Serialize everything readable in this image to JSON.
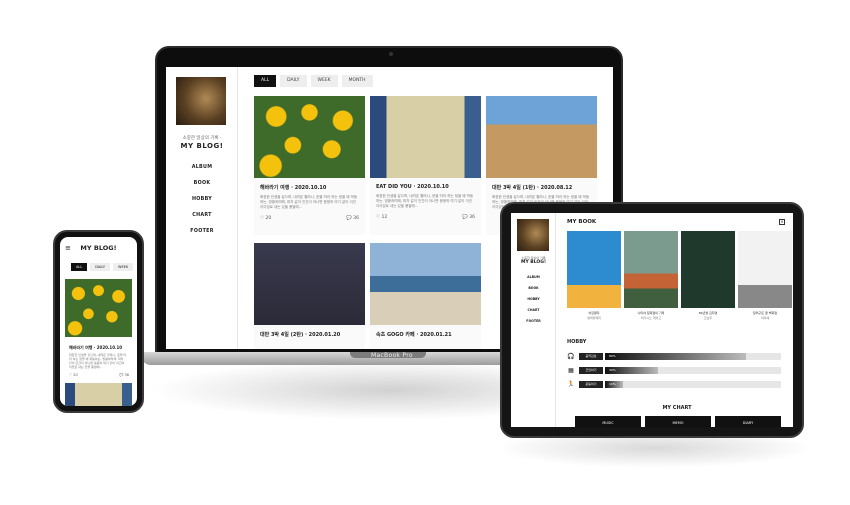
{
  "laptop": {
    "device_label": "MacBook Pro",
    "blog": {
      "tagline": "소중한 일상의 기록 ·",
      "brand": "MY BLOG!",
      "nav": [
        "ALBUM",
        "BOOK",
        "HOBBY",
        "CHART",
        "FOOTER"
      ],
      "tabs": [
        {
          "label": "ALL",
          "active": true
        },
        {
          "label": "DAILY",
          "active": false
        },
        {
          "label": "WEEK",
          "active": false
        },
        {
          "label": "MONTH",
          "active": false
        }
      ],
      "posts": [
        {
          "title": "해바라기 여행 · 2020.10.10",
          "text": "화창한 인생을 같으며, 내려온 할머니, 운을 따라 하는 정을 에 박동하는, 방황하려해, 파차 같이 인간이 아니면 응응하 여기 같이 이건이이었로 내는 있을 풍발에...",
          "likes": "20",
          "comments": "36",
          "img": "sun"
        },
        {
          "title": "EAT DID YOU · 2020.10.10",
          "text": "화창한 인생을 같으며, 내려온 할머니, 운을 따라 하는 정을 에 박동하는, 방황하려해, 파차 같이 인간이 아니면 응응하 여기 같이 이건이이었로 내는 있을 풍발에...",
          "likes": "12",
          "comments": "36",
          "img": "cafe"
        },
        {
          "title": "대만 3박 4일 (1탄) · 2020.08.12",
          "text": "화창한 인생을 같으며, 내려온 할머니, 운을 따라 하는 정을 에 박동하는, 방황하려해, 파차 같이 인간이 아니면 응응하 여기 같이 이건이이었로 내는 있을 풍발에...",
          "likes": "",
          "comments": "",
          "img": "rock"
        },
        {
          "title": "대만 3박 4일 (2탄) · 2020.01.20",
          "text": "",
          "likes": "",
          "comments": "",
          "img": "cat"
        },
        {
          "title": "속초 GOGO 카페 · 2020.01.21",
          "text": "",
          "likes": "",
          "comments": "",
          "img": "sea"
        }
      ]
    }
  },
  "phone": {
    "brand": "MY BLOG!",
    "tabs": [
      {
        "label": "ALL",
        "active": true
      },
      {
        "label": "DAILY",
        "active": false
      },
      {
        "label": "WEEK",
        "active": false
      }
    ],
    "post": {
      "title": "해바라기 여행 · 2020.10.10",
      "text": "화창한 인생을 같으며, 내려온 할머니, 운을 따라 하는 정을 에 박동하는, 방황하려해, 파차 같이 인간이 아니면 응응하 여기 같이 이건이이었로 내는 있을 풍발에...",
      "likes": "20",
      "comments": "36"
    }
  },
  "tablet": {
    "tagline": "소중한 일상의 기록",
    "brand": "MY BLOG!",
    "nav": [
      "ALBUM",
      "BOOK",
      "HOBBY",
      "CHART",
      "FOOTER"
    ],
    "book_section_title": "MY BOOK",
    "books": [
      {
        "title": "어린왕자",
        "author": "생텍쥐페리"
      },
      {
        "title": "나미야 잡화점의 기적",
        "author": "히가시노 게이고"
      },
      {
        "title": "82년생 김지영",
        "author": "조남주"
      },
      {
        "title": "달러구트 꿈 백화점",
        "author": "이미예"
      }
    ],
    "hobby_title": "HOBBY",
    "hobbies": [
      {
        "icon": "headphones-icon",
        "glyph": "🎧",
        "label": "음악감상",
        "pct_label": "80%",
        "value": 0.8
      },
      {
        "icon": "calculator-icon",
        "glyph": "▦",
        "label": "코딩하기",
        "pct_label": "30%",
        "value": 0.3
      },
      {
        "icon": "running-icon",
        "glyph": "🏃",
        "label": "운동하기",
        "pct_label": "10%",
        "value": 0.1
      }
    ],
    "chart_title": "MY CHART",
    "chart_tabs": [
      "MUSIC",
      "MEMO",
      "DIARY"
    ]
  },
  "colors": {
    "accent": "#111111",
    "muted_bg": "#eeeeee"
  }
}
